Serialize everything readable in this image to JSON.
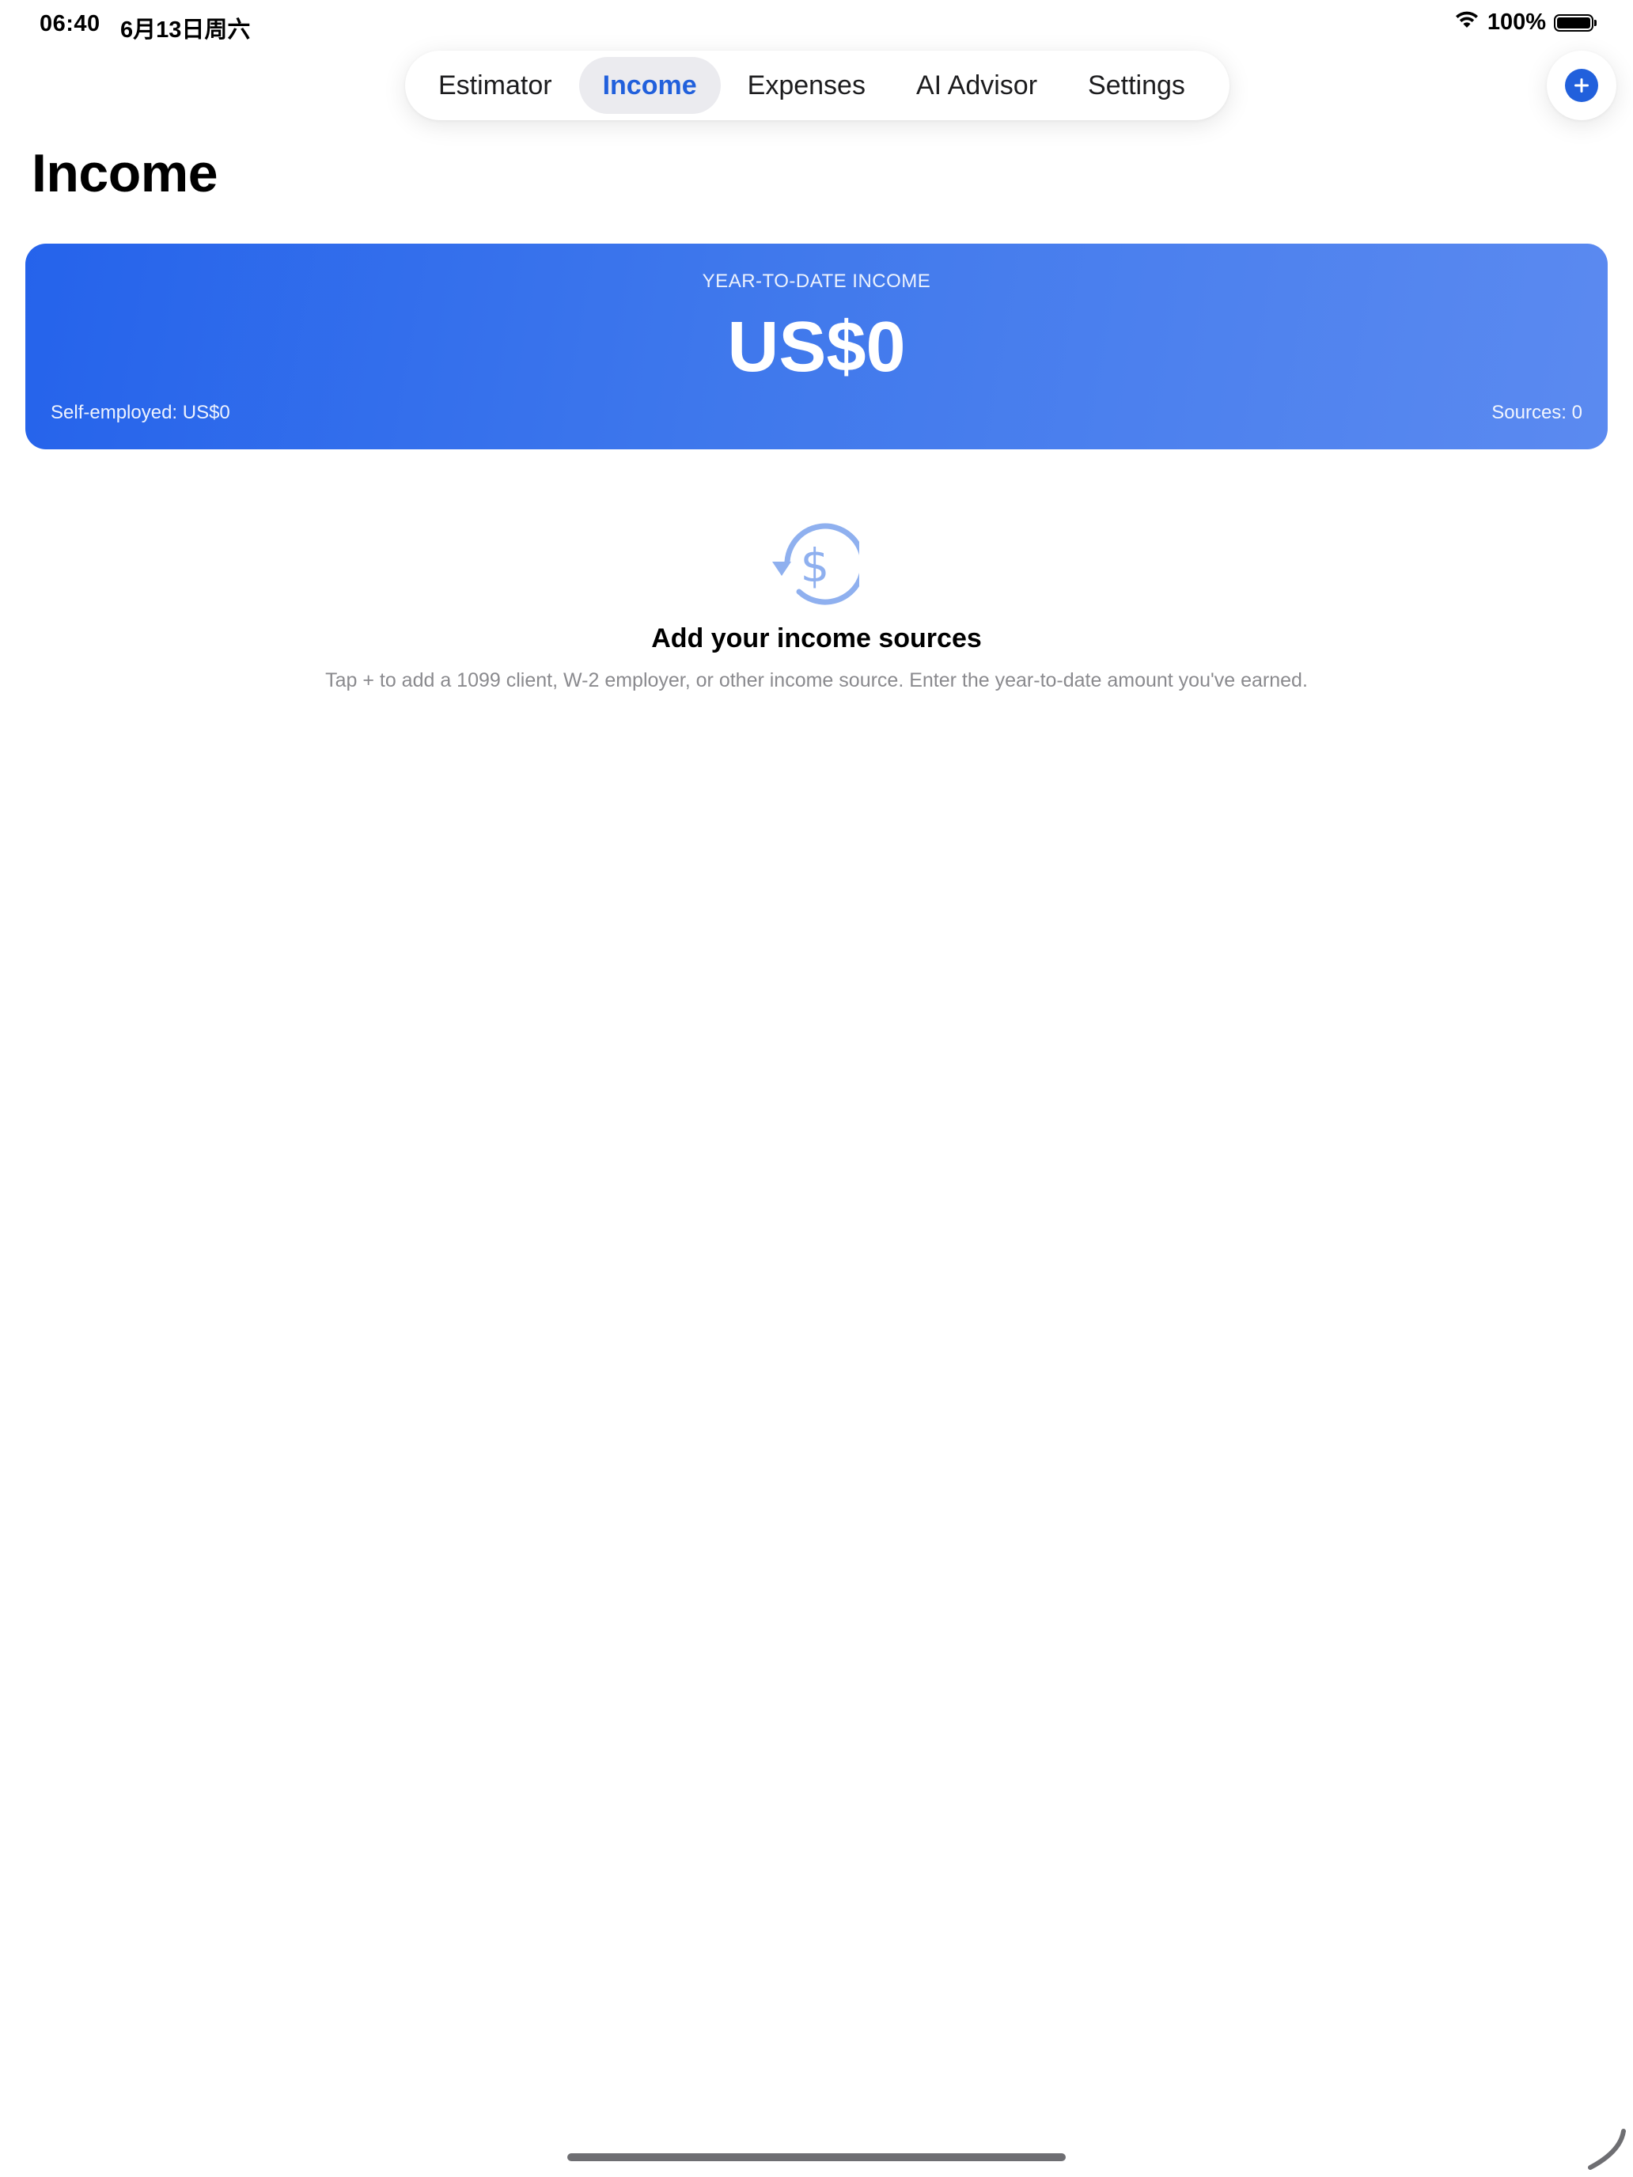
{
  "status_bar": {
    "time": "06:40",
    "date": "6月13日周六",
    "battery_text": "100%",
    "battery_level": 1.0
  },
  "tabs": [
    {
      "label": "Estimator",
      "active": false
    },
    {
      "label": "Income",
      "active": true
    },
    {
      "label": "Expenses",
      "active": false
    },
    {
      "label": "AI Advisor",
      "active": false
    },
    {
      "label": "Settings",
      "active": false
    }
  ],
  "header": {
    "title": "Income",
    "add_icon": "plus-icon"
  },
  "summary": {
    "label": "YEAR-TO-DATE INCOME",
    "amount": "US$0",
    "self_employed": "Self-employed: US$0",
    "sources": "Sources: 0"
  },
  "empty_state": {
    "icon": "dollar-refresh-icon",
    "title": "Add your income sources",
    "description": "Tap + to add a 1099 client, W-2 employer, or other income source. Enter the year-to-date amount you've earned."
  },
  "colors": {
    "accent": "#2160dc",
    "card_start": "#2563eb",
    "card_end": "#5b8af0",
    "empty_icon": "#8fb0ef",
    "muted_text": "#8a8a8e"
  }
}
